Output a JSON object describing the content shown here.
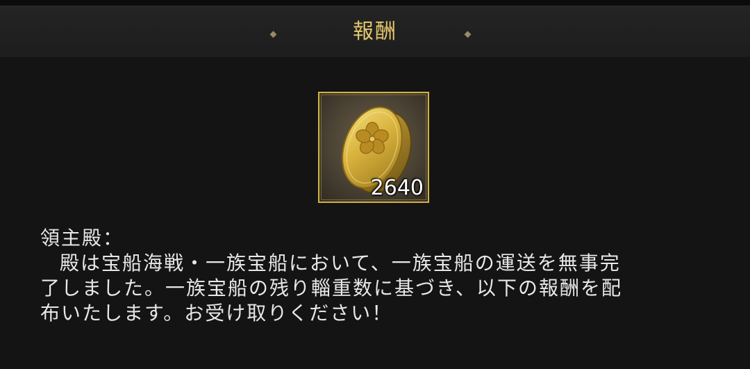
{
  "header": {
    "title": "報酬"
  },
  "reward": {
    "item_icon": "gold-koban-coin-icon",
    "count": "2640",
    "frame_color": "#d4b344"
  },
  "message": {
    "salutation": "領主殿：",
    "line1": "殿は宝船海戦・一族宝船において、一族宝船の運送を無事完",
    "line2": "了しました。一族宝船の残り輜重数に基づき、以下の報酬を配",
    "line3": "布いたします。お受け取りください！"
  },
  "colors": {
    "title": "#e3c66c",
    "text": "#e8e8e8",
    "background": "#141414"
  }
}
